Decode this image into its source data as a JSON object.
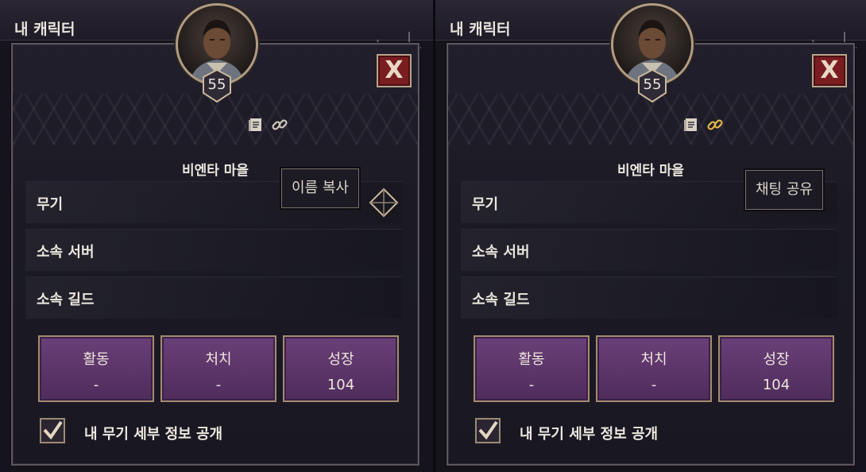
{
  "background_title": "내 캐릭터",
  "panels": [
    {
      "level": "55",
      "village": "비엔타 마을",
      "rows": [
        "무기",
        "소속 서버",
        "소속 길드"
      ],
      "stats": [
        {
          "label": "활동",
          "value": "-"
        },
        {
          "label": "처치",
          "value": "-"
        },
        {
          "label": "성장",
          "value": "104"
        }
      ],
      "checkbox_label": "내 무기 세부 정보 공개",
      "checkbox_checked": true,
      "tooltip": "이름 복사",
      "close_glyph": "X"
    },
    {
      "level": "55",
      "village": "비엔타 마을",
      "rows": [
        "무기",
        "소속 서버",
        "소속 길드"
      ],
      "stats": [
        {
          "label": "활동",
          "value": "-"
        },
        {
          "label": "처치",
          "value": "-"
        },
        {
          "label": "성장",
          "value": "104"
        }
      ],
      "checkbox_label": "내 무기 세부 정보 공개",
      "checkbox_checked": true,
      "tooltip": "채팅 공유",
      "close_glyph": "X"
    }
  ],
  "icons": [
    "document-icon",
    "link-icon",
    "close-icon",
    "avatar-portrait",
    "level-badge-icon",
    "checkmark-icon"
  ],
  "colors": {
    "stat_button": "#5d3569",
    "close_button": "#7a1d20",
    "frame_gold": "#b19b82"
  }
}
